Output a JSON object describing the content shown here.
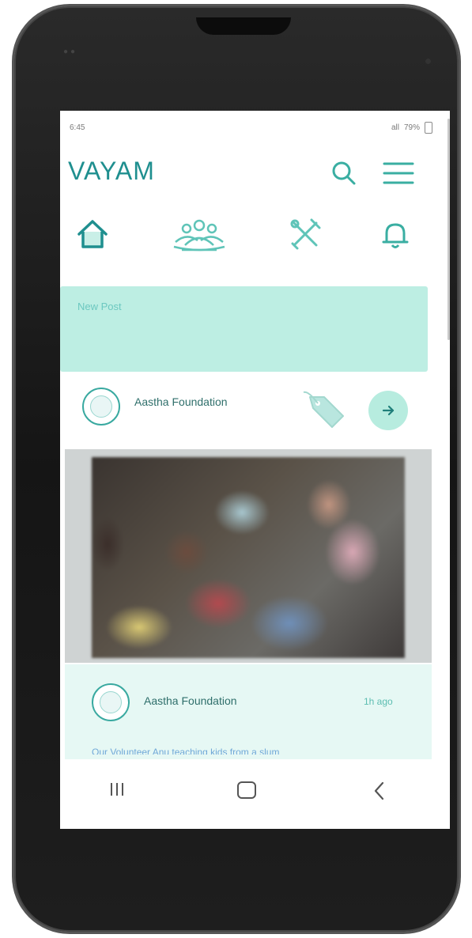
{
  "status_bar": {
    "time": "6:45",
    "signal": "all",
    "battery": "79%"
  },
  "app_bar": {
    "logo": "VAYAM",
    "icons": [
      "search-icon",
      "menu-icon"
    ]
  },
  "nav_tabs": [
    {
      "name": "home",
      "icon": "home-icon"
    },
    {
      "name": "community",
      "icon": "community-icon"
    },
    {
      "name": "tools",
      "icon": "tools-icon"
    },
    {
      "name": "notifications",
      "icon": "bell-icon"
    }
  ],
  "new_post": {
    "label": "New Post"
  },
  "post": {
    "org_name": "Aastha Foundation",
    "tag_icon": "tag-icon",
    "open_icon": "arrow-right-icon",
    "image_alt": "children-activity-photo",
    "footer_org_name": "Aastha Foundation",
    "time_ago": "1h ago",
    "caption": "Our Volunteer Anu teaching kids from a slum"
  },
  "system_nav": {
    "icons": [
      "recent-apps-icon",
      "home-button-icon",
      "back-icon"
    ]
  },
  "colors": {
    "accent": "#1f8f8f",
    "light_teal": "#bdeee3",
    "card_bg": "#e6f8f4"
  }
}
